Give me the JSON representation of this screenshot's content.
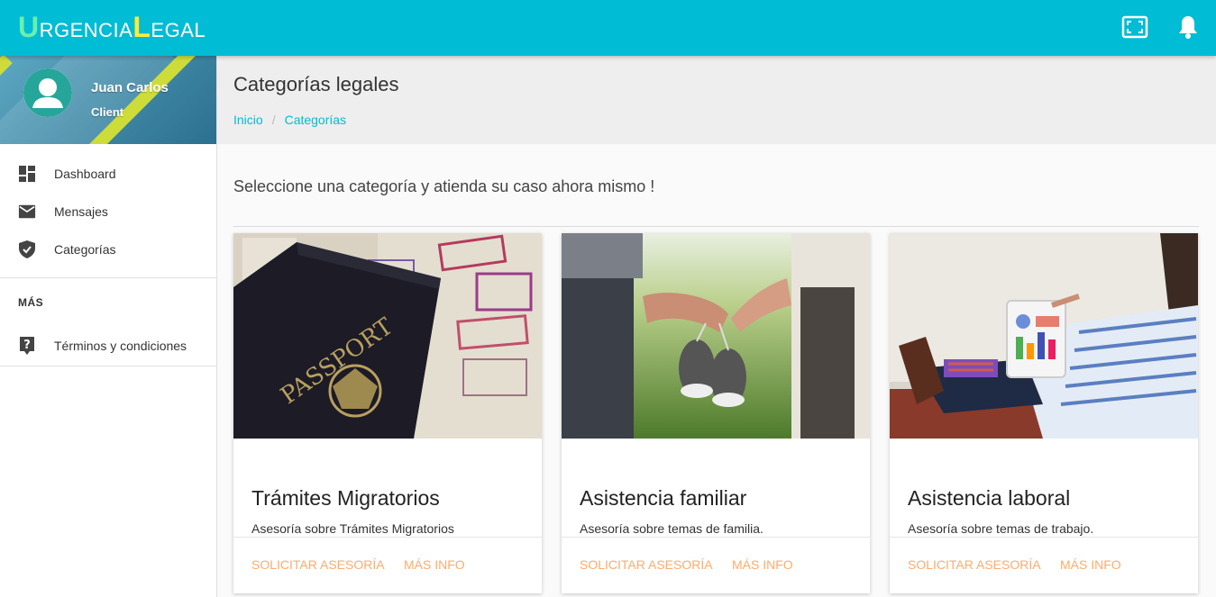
{
  "app": {
    "title_parts": [
      {
        "cap": "U",
        "rest": "RGENCIA"
      },
      {
        "cap": "L",
        "rest": "EGAL"
      }
    ]
  },
  "topbar": {
    "icons": [
      "fullscreen-icon",
      "notifications-bell-icon"
    ]
  },
  "user": {
    "name": "Juan Carlos",
    "role": "Client"
  },
  "sidebar": {
    "items": [
      {
        "label": "Dashboard",
        "icon": "dashboard-icon"
      },
      {
        "label": "Mensajes",
        "icon": "mail-icon"
      },
      {
        "label": "Categorías",
        "icon": "shield-check-icon"
      }
    ],
    "section_header": "MÁS",
    "more_items": [
      {
        "label": "Términos y condiciones",
        "icon": "help-icon"
      }
    ]
  },
  "header": {
    "title": "Categorías legales",
    "breadcrumb": [
      "Inicio",
      "Categorías"
    ]
  },
  "main": {
    "intro": "Seleccione una categoría y atienda su caso ahora mismo !",
    "cards": [
      {
        "title": "Trámites Migratorios",
        "description": "Asesoría sobre Trámites Migratorios",
        "image": "passport-photo",
        "primary_action": "SOLICITAR ASESORÍA",
        "secondary_action": "MÁS INFO"
      },
      {
        "title": "Asistencia familiar",
        "description": "Asesoría sobre temas de familia.",
        "image": "couple-holding-baby-shoes-photo",
        "primary_action": "SOLICITAR ASESORÍA",
        "secondary_action": "MÁS INFO"
      },
      {
        "title": "Asistencia laboral",
        "description": "Asesoría sobre temas de trabajo.",
        "image": "man-with-tablet-chart-photo",
        "primary_action": "SOLICITAR ASESORÍA",
        "secondary_action": "MÁS INFO"
      }
    ]
  },
  "colors": {
    "primary": "#00bcd4",
    "accent_link": "#ffab6b",
    "logo_cap_u": "#69f0ae",
    "logo_cap_l": "#ffeb3b"
  }
}
